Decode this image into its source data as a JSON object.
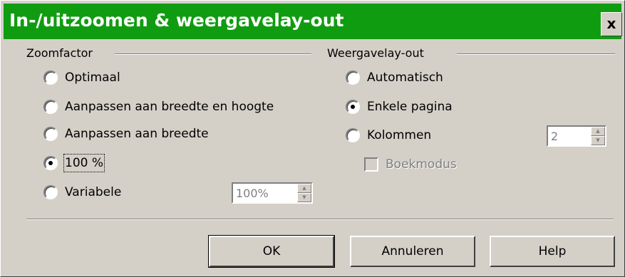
{
  "dialog": {
    "title": "In-/uitzoomen & weergavelay-out",
    "close_label": "x"
  },
  "zoom": {
    "group_label": "Zoomfactor",
    "options": [
      {
        "label": "Optimaal",
        "checked": false
      },
      {
        "label": "Aanpassen aan breedte en hoogte",
        "checked": false
      },
      {
        "label": "Aanpassen aan breedte",
        "checked": false
      },
      {
        "label": "100 %",
        "checked": true
      },
      {
        "label": "Variabele",
        "checked": false
      }
    ],
    "variable_value": "100%"
  },
  "layout": {
    "group_label": "Weergavelay-out",
    "options": [
      {
        "label": "Automatisch",
        "checked": false
      },
      {
        "label": "Enkele pagina",
        "checked": true
      },
      {
        "label": "Kolommen",
        "checked": false
      }
    ],
    "columns_value": "2",
    "book_mode_label": "Boekmodus",
    "book_mode_checked": false
  },
  "buttons": {
    "ok": "OK",
    "cancel": "Annuleren",
    "help": "Help"
  },
  "icons": {
    "spin_up": "spin-up-icon",
    "spin_down": "spin-down-icon",
    "close": "close-icon"
  }
}
